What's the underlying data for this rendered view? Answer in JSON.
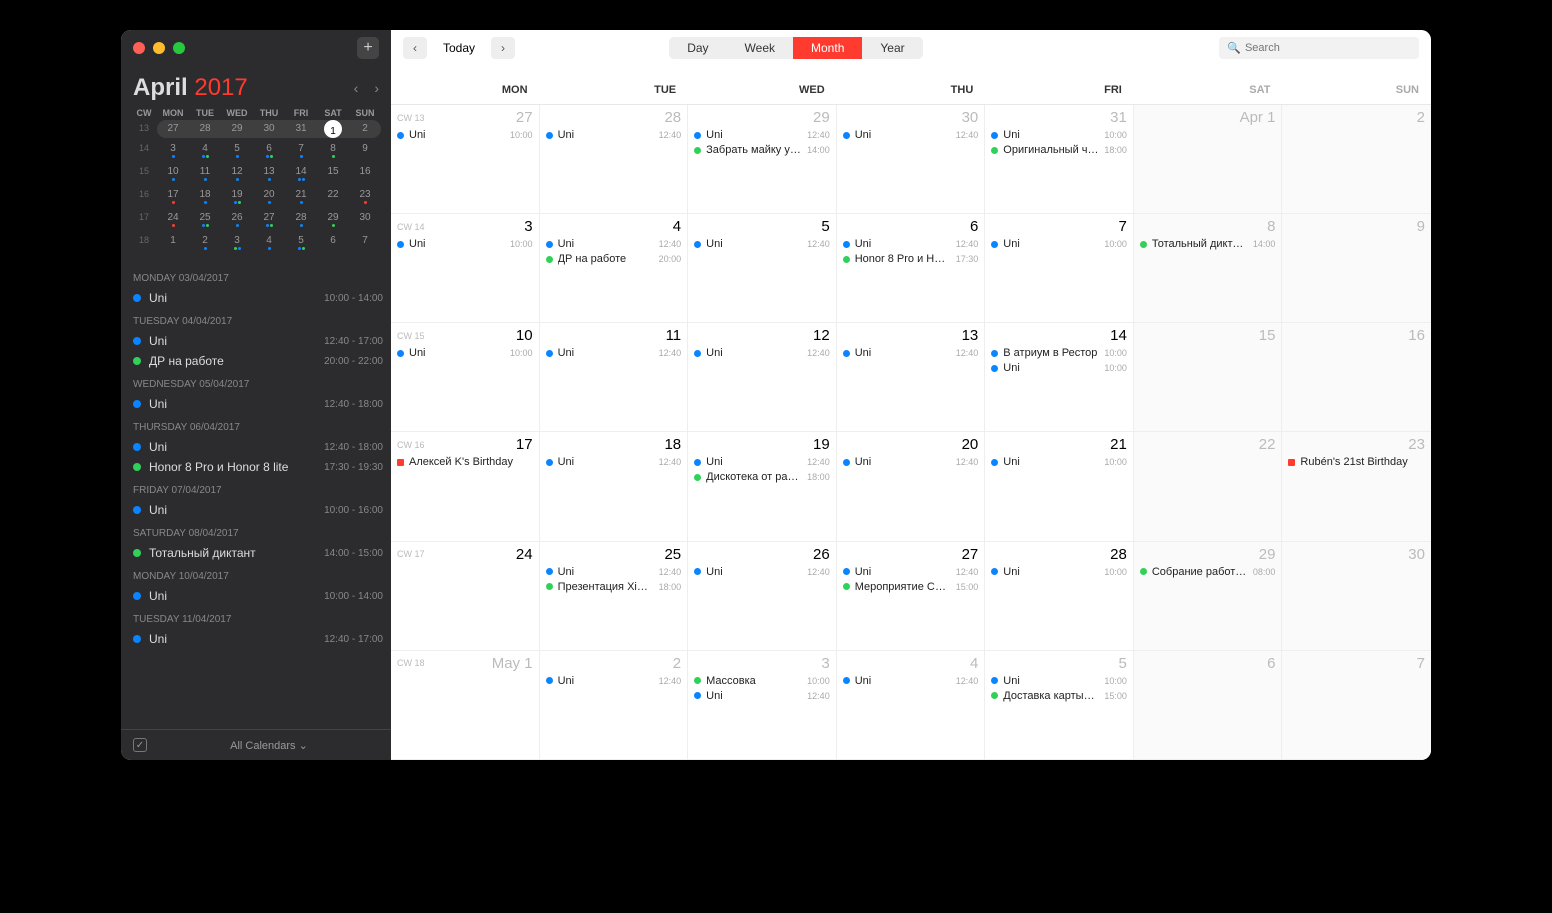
{
  "sidebar": {
    "month": "April",
    "year": "2017",
    "mini_header": [
      "CW",
      "MON",
      "TUE",
      "WED",
      "THU",
      "FRI",
      "SAT",
      "SUN"
    ],
    "mini_rows": [
      {
        "cw": "13",
        "days": [
          {
            "n": "27",
            "dots": []
          },
          {
            "n": "28",
            "dots": []
          },
          {
            "n": "29",
            "dots": []
          },
          {
            "n": "30",
            "dots": []
          },
          {
            "n": "31",
            "dots": []
          },
          {
            "n": "1",
            "today": true,
            "dots": []
          },
          {
            "n": "2",
            "dots": []
          }
        ],
        "today_row": true
      },
      {
        "cw": "14",
        "days": [
          {
            "n": "3",
            "dots": [
              "blue"
            ]
          },
          {
            "n": "4",
            "dots": [
              "blue",
              "green"
            ]
          },
          {
            "n": "5",
            "dots": [
              "blue"
            ]
          },
          {
            "n": "6",
            "dots": [
              "blue",
              "green"
            ]
          },
          {
            "n": "7",
            "dots": [
              "blue"
            ]
          },
          {
            "n": "8",
            "dots": [
              "green"
            ]
          },
          {
            "n": "9",
            "dots": []
          }
        ]
      },
      {
        "cw": "15",
        "days": [
          {
            "n": "10",
            "dots": [
              "blue"
            ]
          },
          {
            "n": "11",
            "dots": [
              "blue"
            ]
          },
          {
            "n": "12",
            "dots": [
              "blue"
            ]
          },
          {
            "n": "13",
            "dots": [
              "blue"
            ]
          },
          {
            "n": "14",
            "dots": [
              "blue",
              "blue"
            ]
          },
          {
            "n": "15",
            "dots": []
          },
          {
            "n": "16",
            "dots": []
          }
        ]
      },
      {
        "cw": "16",
        "days": [
          {
            "n": "17",
            "dots": [
              "red"
            ]
          },
          {
            "n": "18",
            "dots": [
              "blue"
            ]
          },
          {
            "n": "19",
            "dots": [
              "blue",
              "green"
            ]
          },
          {
            "n": "20",
            "dots": [
              "blue"
            ]
          },
          {
            "n": "21",
            "dots": [
              "blue"
            ]
          },
          {
            "n": "22",
            "dots": []
          },
          {
            "n": "23",
            "dots": [
              "red"
            ]
          }
        ]
      },
      {
        "cw": "17",
        "days": [
          {
            "n": "24",
            "dots": [
              "red"
            ]
          },
          {
            "n": "25",
            "dots": [
              "blue",
              "green"
            ]
          },
          {
            "n": "26",
            "dots": [
              "blue"
            ]
          },
          {
            "n": "27",
            "dots": [
              "blue",
              "green"
            ]
          },
          {
            "n": "28",
            "dots": [
              "blue"
            ]
          },
          {
            "n": "29",
            "dots": [
              "green"
            ]
          },
          {
            "n": "30",
            "dots": []
          }
        ]
      },
      {
        "cw": "18",
        "days": [
          {
            "n": "1",
            "dots": []
          },
          {
            "n": "2",
            "dots": [
              "blue"
            ]
          },
          {
            "n": "3",
            "dots": [
              "green",
              "blue"
            ]
          },
          {
            "n": "4",
            "dots": [
              "blue"
            ]
          },
          {
            "n": "5",
            "dots": [
              "blue",
              "green"
            ]
          },
          {
            "n": "6",
            "dots": []
          },
          {
            "n": "7",
            "dots": []
          }
        ]
      }
    ],
    "agenda": [
      {
        "header": "MONDAY 03/04/2017",
        "items": [
          {
            "color": "blue",
            "title": "Uni",
            "time": "10:00 - 14:00"
          }
        ]
      },
      {
        "header": "TUESDAY 04/04/2017",
        "items": [
          {
            "color": "blue",
            "title": "Uni",
            "time": "12:40 - 17:00"
          },
          {
            "color": "green",
            "title": "ДР на работе",
            "time": "20:00 - 22:00"
          }
        ]
      },
      {
        "header": "WEDNESDAY 05/04/2017",
        "items": [
          {
            "color": "blue",
            "title": "Uni",
            "time": "12:40 - 18:00"
          }
        ]
      },
      {
        "header": "THURSDAY 06/04/2017",
        "items": [
          {
            "color": "blue",
            "title": "Uni",
            "time": "12:40 - 18:00"
          },
          {
            "color": "green",
            "title": "Honor 8 Pro и Honor 8 lite",
            "time": "17:30 - 19:30"
          }
        ]
      },
      {
        "header": "FRIDAY 07/04/2017",
        "items": [
          {
            "color": "blue",
            "title": "Uni",
            "time": "10:00 - 16:00"
          }
        ]
      },
      {
        "header": "SATURDAY 08/04/2017",
        "items": [
          {
            "color": "green",
            "title": "Тотальный диктант",
            "time": "14:00 - 15:00"
          }
        ]
      },
      {
        "header": "MONDAY 10/04/2017",
        "items": [
          {
            "color": "blue",
            "title": "Uni",
            "time": "10:00 - 14:00"
          }
        ]
      },
      {
        "header": "TUESDAY 11/04/2017",
        "items": [
          {
            "color": "blue",
            "title": "Uni",
            "time": "12:40 - 17:00"
          }
        ]
      }
    ],
    "footer_label": "All Calendars"
  },
  "toolbar": {
    "today": "Today",
    "views": [
      "Day",
      "Week",
      "Month",
      "Year"
    ],
    "active_view": "Month",
    "search_placeholder": "Search"
  },
  "weekdays": [
    "MON",
    "TUE",
    "WED",
    "THU",
    "FRI",
    "SAT",
    "SUN"
  ],
  "weeks": [
    {
      "cw": "CW 13",
      "days": [
        {
          "num": "27",
          "other": true,
          "events": [
            {
              "c": "blue",
              "t": "Uni",
              "time": "10:00"
            }
          ]
        },
        {
          "num": "28",
          "other": true,
          "events": [
            {
              "c": "blue",
              "t": "Uni",
              "time": "12:40"
            }
          ]
        },
        {
          "num": "29",
          "other": true,
          "events": [
            {
              "c": "blue",
              "t": "Uni",
              "time": "12:40"
            },
            {
              "c": "green",
              "t": "Забрать майку у…",
              "time": "14:00"
            }
          ]
        },
        {
          "num": "30",
          "other": true,
          "events": [
            {
              "c": "blue",
              "t": "Uni",
              "time": "12:40"
            }
          ]
        },
        {
          "num": "31",
          "other": true,
          "events": [
            {
              "c": "blue",
              "t": "Uni",
              "time": "10:00"
            },
            {
              "c": "green",
              "t": "Оригинальный ч…",
              "time": "18:00"
            }
          ]
        },
        {
          "num": "Apr 1",
          "weekend": true,
          "events": []
        },
        {
          "num": "2",
          "weekend": true,
          "events": []
        }
      ]
    },
    {
      "cw": "CW 14",
      "days": [
        {
          "num": "3",
          "events": [
            {
              "c": "blue",
              "t": "Uni",
              "time": "10:00"
            }
          ]
        },
        {
          "num": "4",
          "events": [
            {
              "c": "blue",
              "t": "Uni",
              "time": "12:40"
            },
            {
              "c": "green",
              "t": "ДР на работе",
              "time": "20:00"
            }
          ]
        },
        {
          "num": "5",
          "events": [
            {
              "c": "blue",
              "t": "Uni",
              "time": "12:40"
            }
          ]
        },
        {
          "num": "6",
          "events": [
            {
              "c": "blue",
              "t": "Uni",
              "time": "12:40"
            },
            {
              "c": "green",
              "t": "Honor 8 Pro и Ho…",
              "time": "17:30"
            }
          ]
        },
        {
          "num": "7",
          "events": [
            {
              "c": "blue",
              "t": "Uni",
              "time": "10:00"
            }
          ]
        },
        {
          "num": "8",
          "weekend": true,
          "events": [
            {
              "c": "green",
              "t": "Тотальный дикта…",
              "time": "14:00"
            }
          ]
        },
        {
          "num": "9",
          "weekend": true,
          "events": []
        }
      ]
    },
    {
      "cw": "CW 15",
      "days": [
        {
          "num": "10",
          "events": [
            {
              "c": "blue",
              "t": "Uni",
              "time": "10:00"
            }
          ]
        },
        {
          "num": "11",
          "events": [
            {
              "c": "blue",
              "t": "Uni",
              "time": "12:40"
            }
          ]
        },
        {
          "num": "12",
          "events": [
            {
              "c": "blue",
              "t": "Uni",
              "time": "12:40"
            }
          ]
        },
        {
          "num": "13",
          "events": [
            {
              "c": "blue",
              "t": "Uni",
              "time": "12:40"
            }
          ]
        },
        {
          "num": "14",
          "events": [
            {
              "c": "blue",
              "t": "В атриум в Рестор",
              "time": "10:00"
            },
            {
              "c": "blue",
              "t": "Uni",
              "time": "10:00"
            }
          ]
        },
        {
          "num": "15",
          "weekend": true,
          "events": []
        },
        {
          "num": "16",
          "weekend": true,
          "events": []
        }
      ]
    },
    {
      "cw": "CW 16",
      "days": [
        {
          "num": "17",
          "events": [
            {
              "c": "red",
              "sq": true,
              "t": "Алексей K's Birthday",
              "time": ""
            }
          ]
        },
        {
          "num": "18",
          "events": [
            {
              "c": "blue",
              "t": "Uni",
              "time": "12:40"
            }
          ]
        },
        {
          "num": "19",
          "events": [
            {
              "c": "blue",
              "t": "Uni",
              "time": "12:40"
            },
            {
              "c": "green",
              "t": "Дискотека от ра…",
              "time": "18:00"
            }
          ]
        },
        {
          "num": "20",
          "events": [
            {
              "c": "blue",
              "t": "Uni",
              "time": "12:40"
            }
          ]
        },
        {
          "num": "21",
          "events": [
            {
              "c": "blue",
              "t": "Uni",
              "time": "10:00"
            }
          ]
        },
        {
          "num": "22",
          "weekend": true,
          "events": []
        },
        {
          "num": "23",
          "weekend": true,
          "events": [
            {
              "c": "red",
              "sq": true,
              "t": "Rubén's 21st Birthday",
              "time": ""
            }
          ]
        }
      ]
    },
    {
      "cw": "CW 17",
      "days": [
        {
          "num": "24",
          "events": []
        },
        {
          "num": "25",
          "events": [
            {
              "c": "blue",
              "t": "Uni",
              "time": "12:40"
            },
            {
              "c": "green",
              "t": "Презентация Xia…",
              "time": "18:00"
            }
          ]
        },
        {
          "num": "26",
          "events": [
            {
              "c": "blue",
              "t": "Uni",
              "time": "12:40"
            }
          ]
        },
        {
          "num": "27",
          "events": [
            {
              "c": "blue",
              "t": "Uni",
              "time": "12:40"
            },
            {
              "c": "green",
              "t": "Мероприятие Са…",
              "time": "15:00"
            }
          ]
        },
        {
          "num": "28",
          "events": [
            {
              "c": "blue",
              "t": "Uni",
              "time": "10:00"
            }
          ]
        },
        {
          "num": "29",
          "weekend": true,
          "events": [
            {
              "c": "green",
              "t": "Собрание работ…",
              "time": "08:00"
            }
          ]
        },
        {
          "num": "30",
          "weekend": true,
          "events": []
        }
      ]
    },
    {
      "cw": "CW 18",
      "days": [
        {
          "num": "May 1",
          "other": true,
          "events": []
        },
        {
          "num": "2",
          "other": true,
          "events": [
            {
              "c": "blue",
              "t": "Uni",
              "time": "12:40"
            }
          ]
        },
        {
          "num": "3",
          "other": true,
          "events": [
            {
              "c": "green",
              "t": "Массовка",
              "time": "10:00"
            },
            {
              "c": "blue",
              "t": "Uni",
              "time": "12:40"
            }
          ]
        },
        {
          "num": "4",
          "other": true,
          "events": [
            {
              "c": "blue",
              "t": "Uni",
              "time": "12:40"
            }
          ]
        },
        {
          "num": "5",
          "other": true,
          "events": [
            {
              "c": "blue",
              "t": "Uni",
              "time": "10:00"
            },
            {
              "c": "green",
              "t": "Доставка карты…",
              "time": "15:00"
            }
          ]
        },
        {
          "num": "6",
          "other": true,
          "weekend": true,
          "events": []
        },
        {
          "num": "7",
          "other": true,
          "weekend": true,
          "events": []
        }
      ]
    }
  ]
}
